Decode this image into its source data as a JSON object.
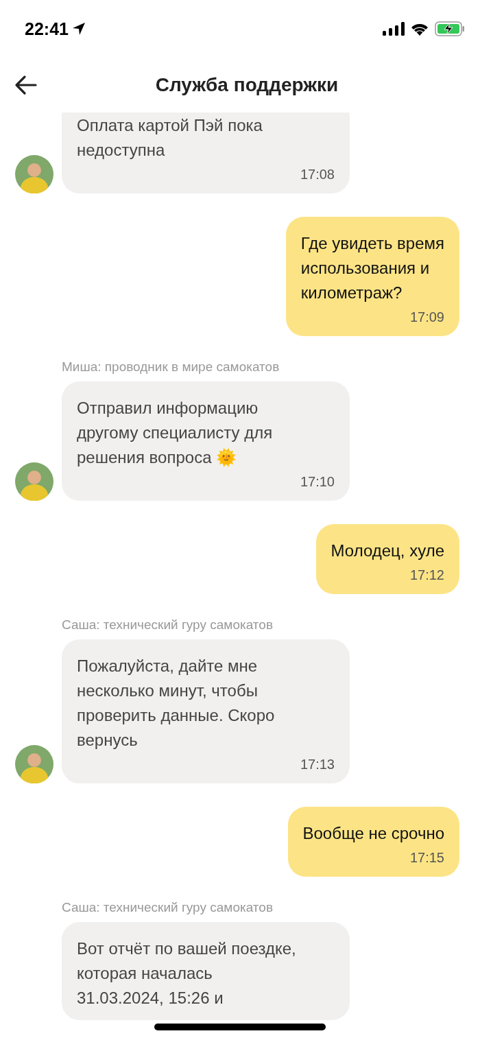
{
  "status_bar": {
    "time": "22:41"
  },
  "header": {
    "title": "Служба поддержки"
  },
  "messages": [
    {
      "kind": "incoming",
      "lines": [
        "Оплата картой Пэй пока",
        "недоступна"
      ],
      "time": "17:08",
      "avatar": true
    },
    {
      "kind": "outgoing",
      "lines": [
        "Где увидеть время",
        "использования и",
        "километраж?"
      ],
      "time": "17:09"
    },
    {
      "kind": "incoming",
      "sender": "Миша: проводник в мире самокатов",
      "lines": [
        "Отправил информацию",
        "другому специалисту для",
        "решения вопроса 🌞"
      ],
      "time": "17:10",
      "avatar": true
    },
    {
      "kind": "outgoing",
      "lines": [
        "Молодец, хуле"
      ],
      "time": "17:12"
    },
    {
      "kind": "incoming",
      "sender": "Саша: технический гуру самокатов",
      "lines": [
        "Пожалуйста, дайте мне",
        "несколько минут, чтобы",
        "проверить данные. Скоро",
        "вернусь"
      ],
      "time": "17:13",
      "avatar": true
    },
    {
      "kind": "outgoing",
      "lines": [
        "Вообще не срочно"
      ],
      "time": "17:15"
    },
    {
      "kind": "incoming",
      "sender": "Саша: технический гуру самокатов",
      "lines": [
        "Вот отчёт по вашей поездке,",
        "которая началась",
        "31.03.2024, 15:26 и"
      ],
      "avatar": false
    }
  ]
}
